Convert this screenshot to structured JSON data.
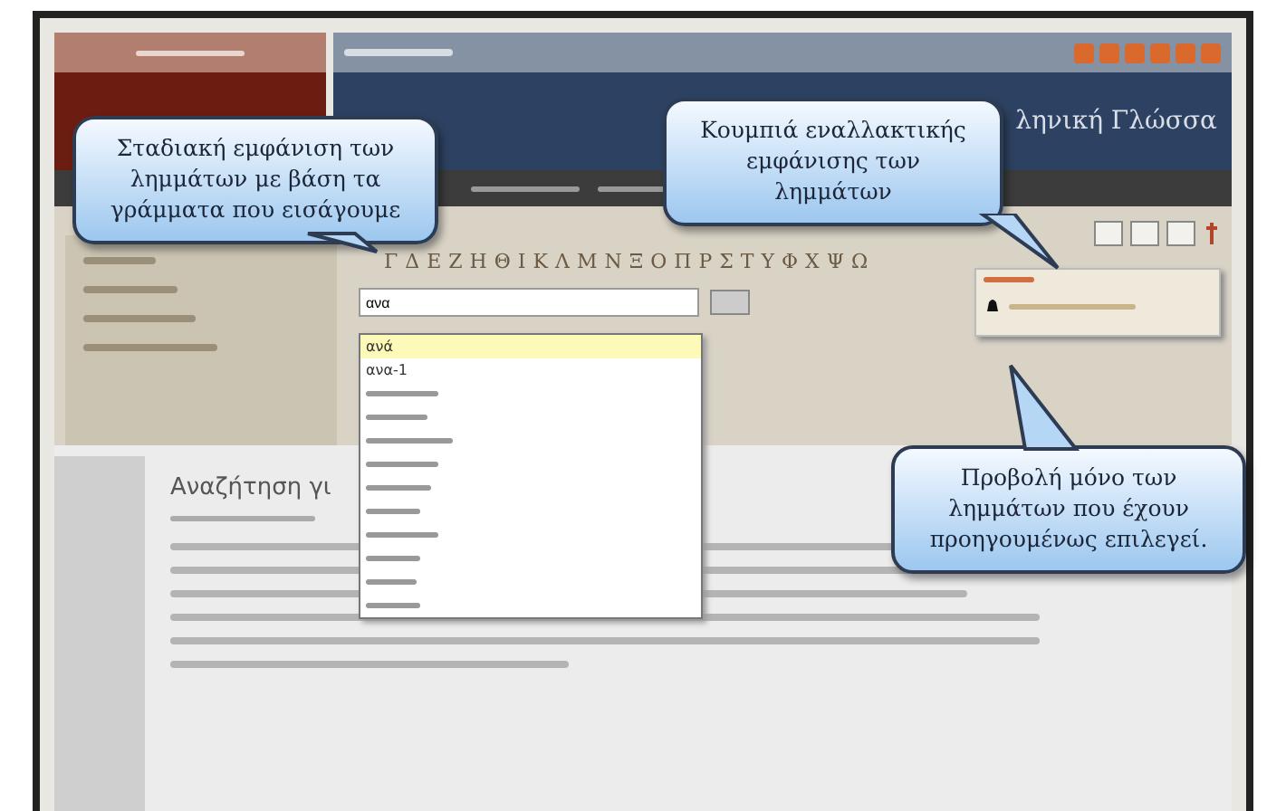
{
  "header": {
    "title": "ληνική Γλώσσα"
  },
  "alphabet": [
    "Γ",
    "Δ",
    "Ε",
    "Ζ",
    "Η",
    "Θ",
    "Ι",
    "Κ",
    "Λ",
    "Μ",
    "Ν",
    "Ξ",
    "Ο",
    "Π",
    "Ρ",
    "Σ",
    "Τ",
    "Υ",
    "Φ",
    "Χ",
    "Ψ",
    "Ω"
  ],
  "search": {
    "value": "ανα",
    "suggestions": [
      {
        "label": "ανά",
        "selected": true
      },
      {
        "label": "ανα-1",
        "selected": false
      }
    ]
  },
  "content": {
    "heading": "Αναζήτηση γι"
  },
  "callouts": [
    {
      "text": "Σταδιακή εμφάνιση των λημμάτων με βάση τα γράμματα που εισάγουμε"
    },
    {
      "text": "Κουμπιά εναλλακτικής εμφάνισης των λημμάτων"
    },
    {
      "text": "Προβολή μόνο των λημμάτων που έχουν προηγουμένως επιλεγεί."
    }
  ]
}
